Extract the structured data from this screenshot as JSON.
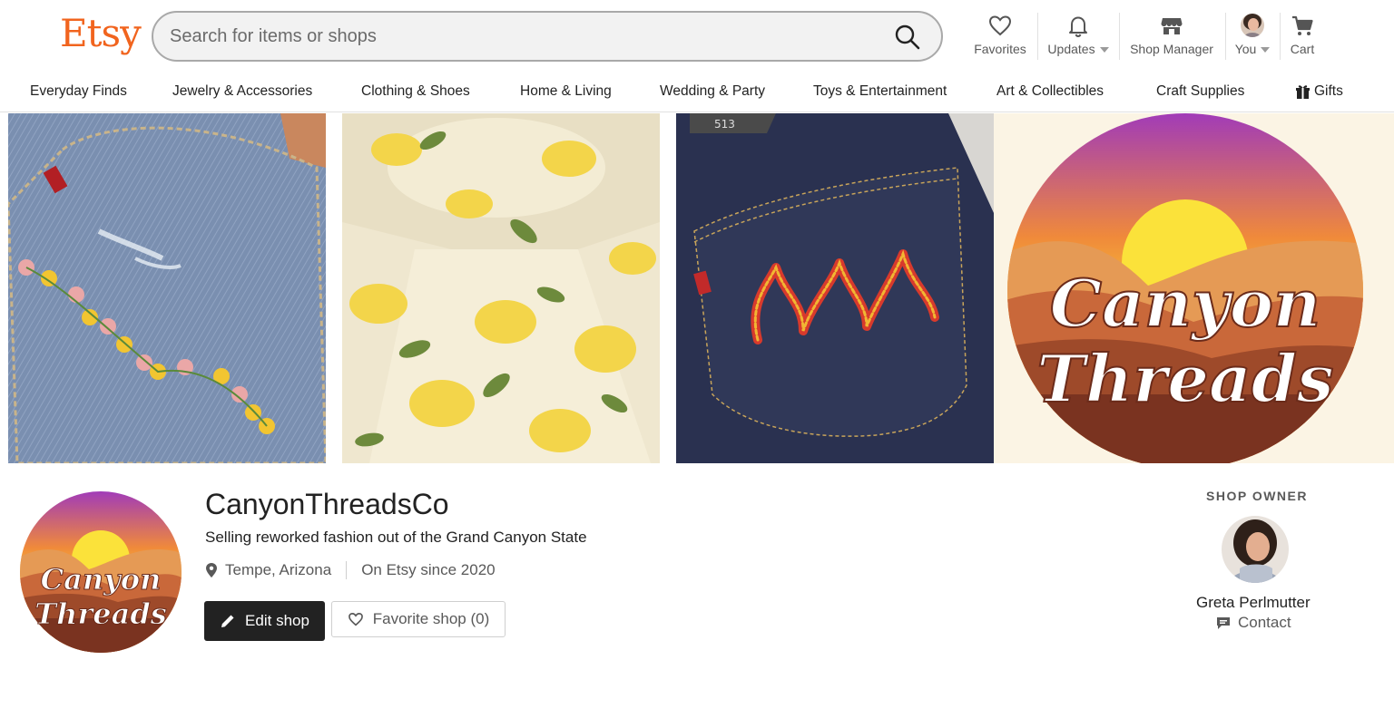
{
  "header": {
    "logo": "Etsy",
    "search_placeholder": "Search for items or shops",
    "nav": {
      "favorites": "Favorites",
      "updates": "Updates",
      "shop_manager": "Shop Manager",
      "you": "You",
      "cart": "Cart"
    }
  },
  "categories": [
    "Everyday Finds",
    "Jewelry & Accessories",
    "Clothing & Shoes",
    "Home & Living",
    "Wedding & Party",
    "Toys & Entertainment",
    "Art & Collectibles",
    "Craft Supplies",
    "Gifts"
  ],
  "banner": {
    "logo_lines": [
      "Canyon",
      "Threads"
    ],
    "jeans_size_tag": "513"
  },
  "shop": {
    "name": "CanyonThreadsCo",
    "tagline": "Selling reworked fashion out of the Grand Canyon State",
    "location": "Tempe, Arizona",
    "since": "On Etsy since 2020",
    "edit_button": "Edit shop",
    "favorite_button": "Favorite shop (0)",
    "logo_lines": [
      "Canyon",
      "Threads"
    ]
  },
  "owner": {
    "title": "SHOP OWNER",
    "name": "Greta Perlmutter",
    "contact": "Contact"
  },
  "colors": {
    "brand": "#f1641e",
    "dark_button": "#222222"
  }
}
